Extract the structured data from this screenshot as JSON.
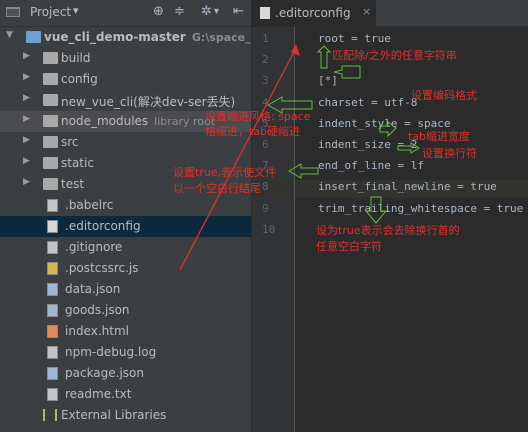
{
  "project_panel": {
    "title": "Project",
    "toolbar_icons": [
      "globe-icon",
      "sliders-icon",
      "gear-icon",
      "hide-icon"
    ]
  },
  "tree": [
    {
      "label": "vue_cli_demo-master",
      "hint": "G:\\space_wel",
      "type": "folder-blue",
      "level": 0,
      "arrow": "▼"
    },
    {
      "label": "build",
      "type": "folder",
      "level": 1,
      "arrow": "▶"
    },
    {
      "label": "config",
      "type": "folder",
      "level": 1,
      "arrow": "▶"
    },
    {
      "label": "new_vue_cli(解决dev-ser丢失)",
      "type": "folder",
      "level": 1,
      "arrow": "▶"
    },
    {
      "label": "node_modules",
      "hint": "library root",
      "type": "folder",
      "level": 1,
      "arrow": "▶",
      "state": "excluded"
    },
    {
      "label": "src",
      "type": "folder",
      "level": 1,
      "arrow": "▶"
    },
    {
      "label": "static",
      "type": "folder",
      "level": 1,
      "arrow": "▶"
    },
    {
      "label": "test",
      "type": "folder",
      "level": 1,
      "arrow": "▶"
    },
    {
      "label": ".babelrc",
      "type": "file",
      "level": 2
    },
    {
      "label": ".editorconfig",
      "type": "file-cfg",
      "level": 2,
      "state": "selected"
    },
    {
      "label": ".gitignore",
      "type": "file",
      "level": 2
    },
    {
      "label": ".postcssrc.js",
      "type": "file-js",
      "level": 2
    },
    {
      "label": "data.json",
      "type": "file-json",
      "level": 2
    },
    {
      "label": "goods.json",
      "type": "file-json",
      "level": 2
    },
    {
      "label": "index.html",
      "type": "file-html",
      "level": 2
    },
    {
      "label": "npm-debug.log",
      "type": "file",
      "level": 2
    },
    {
      "label": "package.json",
      "type": "file-json",
      "level": 2
    },
    {
      "label": "readme.txt",
      "type": "file",
      "level": 2
    },
    {
      "label": "External Libraries",
      "type": "library",
      "level": 1
    }
  ],
  "editor": {
    "tab_label": ".editorconfig",
    "tab_close": "×",
    "lines": [
      {
        "num": "1",
        "code": "root = true"
      },
      {
        "num": "2",
        "code": ""
      },
      {
        "num": "3",
        "code": "[*]"
      },
      {
        "num": "4",
        "code": "charset = utf-8"
      },
      {
        "num": "5",
        "code": "indent_style = space"
      },
      {
        "num": "6",
        "code": "indent_size = 2"
      },
      {
        "num": "7",
        "code": "end_of_line = lf"
      },
      {
        "num": "8",
        "code": "insert_final_newline = true"
      },
      {
        "num": "9",
        "code": "trim_trailing_whitespace = true"
      },
      {
        "num": "10",
        "code": ""
      }
    ]
  },
  "annotations": {
    "match_any": "匹配除/之外的任意字符串",
    "set_charset": "设置编码格式",
    "indent_style_1": "设置缩进风格: space",
    "indent_style_2": "格缩进，tab硬缩进",
    "indent_size": "tab缩进宽度",
    "end_of_line": "设置换行符",
    "final_newline_1": "设置true,表示使文件",
    "final_newline_2": "以一个空白行结尾",
    "trim_1": "设为true表示会去除换行首的",
    "trim_2": "任意空白字符"
  },
  "colors": {
    "annotation": "#e0302a",
    "arrow_green": "#5fbf3a",
    "selection": "#0d293e"
  }
}
